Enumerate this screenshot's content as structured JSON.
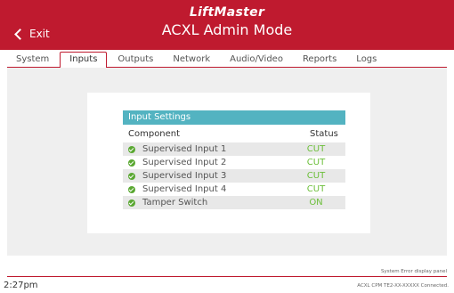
{
  "header": {
    "exit_label": "Exit",
    "brand": "LiftMaster",
    "title": "ACXL Admin Mode"
  },
  "tabs": [
    {
      "label": "System",
      "active": false
    },
    {
      "label": "Inputs",
      "active": true
    },
    {
      "label": "Outputs",
      "active": false
    },
    {
      "label": "Network",
      "active": false
    },
    {
      "label": "Audio/Video",
      "active": false
    },
    {
      "label": "Reports",
      "active": false
    },
    {
      "label": "Logs",
      "active": false
    }
  ],
  "panel": {
    "title": "Input Settings",
    "col_component": "Component",
    "col_status": "Status",
    "rows": [
      {
        "component": "Supervised Input 1",
        "status": "CUT"
      },
      {
        "component": "Supervised Input 2",
        "status": "CUT"
      },
      {
        "component": "Supervised Input 3",
        "status": "CUT"
      },
      {
        "component": "Supervised Input 4",
        "status": "CUT"
      },
      {
        "component": "Tamper Switch",
        "status": "ON"
      }
    ]
  },
  "footer": {
    "error_panel": "System Error display panel",
    "time": "2:27pm",
    "connection": "ACXL CPM TE2-XX-XXXXX Connected."
  },
  "colors": {
    "header": "#bf1a2f",
    "accent": "#53b3c1",
    "status_ok": "#6cbf3a"
  }
}
